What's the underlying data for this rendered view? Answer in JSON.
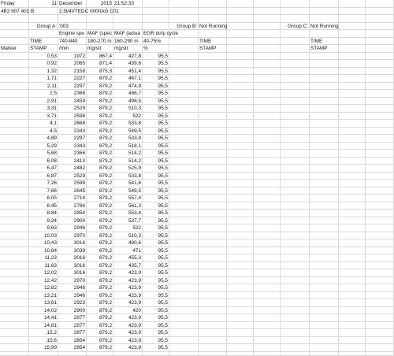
{
  "header_rows": [
    [
      "Friday",
      "11",
      "December",
      "2015",
      "21:52:33",
      "",
      "",
      "",
      "",
      "",
      "",
      "",
      "",
      ""
    ],
    [
      "4B2 907 401 B",
      "",
      "2,5l/4VTEDC 0000AG D01",
      "",
      "",
      "",
      "",
      "",
      "",
      "",
      "",
      "",
      "",
      ""
    ],
    [
      "",
      "",
      "",
      "",
      "",
      "",
      "",
      "",
      "",
      "",
      "",
      "",
      "",
      ""
    ],
    [
      "",
      "Group A:",
      "'003",
      "",
      "",
      "",
      "Group B:",
      "Not Running",
      "",
      "",
      "Group C:",
      "Not Running",
      "",
      ""
    ],
    [
      "",
      "",
      "Engine spe",
      "MAF (spec",
      "MAF (actua",
      "EGR duty cycle",
      "",
      "",
      "",
      "",
      "",
      "",
      "",
      ""
    ],
    [
      "",
      "TIME",
      "740-840",
      "180-270 m",
      "160-290 m",
      "40-75%",
      "",
      "TIME",
      "",
      "",
      "",
      "TIME",
      "",
      ""
    ],
    [
      "Marker",
      "STAMP",
      "/min",
      "mg/str",
      "mg/str",
      "%",
      "",
      "STAMP",
      "",
      "",
      "",
      "STAMP",
      "",
      ""
    ]
  ],
  "rows": [
    [
      "0,53",
      "1972",
      "867,4",
      "427,8",
      "95,5"
    ],
    [
      "0,92",
      "2065",
      "871,4",
      "439,6",
      "95,5"
    ],
    [
      "1,32",
      "2158",
      "875,3",
      "451,4",
      "95,5"
    ],
    [
      "1,71",
      "2227",
      "879,2",
      "467,1",
      "95,5"
    ],
    [
      "2,11",
      "2297",
      "879,2",
      "474,9",
      "95,5"
    ],
    [
      "2,5",
      "2366",
      "879,2",
      "486,7",
      "95,5"
    ],
    [
      "2,91",
      "2459",
      "879,2",
      "498,5",
      "95,5"
    ],
    [
      "3,31",
      "2529",
      "879,2",
      "510,3",
      "95,5"
    ],
    [
      "3,71",
      "2598",
      "879,2",
      "522",
      "95,5"
    ],
    [
      "4,1",
      "2668",
      "879,2",
      "533,8",
      "95,5"
    ],
    [
      "4,5",
      "2343",
      "879,2",
      "549,5",
      "95,5"
    ],
    [
      "4,89",
      "2297",
      "879,2",
      "533,8",
      "95,5"
    ],
    [
      "5,29",
      "2343",
      "879,2",
      "518,1",
      "95,5"
    ],
    [
      "5,68",
      "2366",
      "879,2",
      "514,2",
      "95,5"
    ],
    [
      "6,08",
      "2413",
      "879,2",
      "514,2",
      "95,5"
    ],
    [
      "6,47",
      "2482",
      "879,2",
      "525,9",
      "95,5"
    ],
    [
      "6,87",
      "2529",
      "879,2",
      "533,8",
      "95,5"
    ],
    [
      "7,26",
      "2598",
      "879,2",
      "541,6",
      "95,5"
    ],
    [
      "7,66",
      "2645",
      "879,2",
      "549,5",
      "95,5"
    ],
    [
      "8,05",
      "2714",
      "879,2",
      "557,4",
      "95,5"
    ],
    [
      "8,45",
      "2784",
      "879,2",
      "561,3",
      "95,5"
    ],
    [
      "8,84",
      "2854",
      "879,2",
      "553,4",
      "95,5"
    ],
    [
      "9,24",
      "2900",
      "879,2",
      "537,7",
      "95,5"
    ],
    [
      "9,63",
      "2946",
      "879,2",
      "522",
      "95,5"
    ],
    [
      "10,03",
      "2970",
      "879,2",
      "510,3",
      "95,5"
    ],
    [
      "10,43",
      "3016",
      "879,2",
      "490,6",
      "95,5"
    ],
    [
      "10,84",
      "3039",
      "879,2",
      "471",
      "95,5"
    ],
    [
      "11,23",
      "3016",
      "879,2",
      "455,3",
      "95,5"
    ],
    [
      "11,63",
      "3016",
      "879,2",
      "435,7",
      "95,5"
    ],
    [
      "12,02",
      "3016",
      "879,2",
      "423,9",
      "95,5"
    ],
    [
      "12,42",
      "2970",
      "879,2",
      "423,9",
      "95,5"
    ],
    [
      "12,82",
      "2946",
      "879,2",
      "423,9",
      "95,5"
    ],
    [
      "13,21",
      "2946",
      "879,2",
      "423,9",
      "95,5"
    ],
    [
      "13,61",
      "2923",
      "879,2",
      "423,9",
      "95,5"
    ],
    [
      "14,02",
      "2900",
      "879,2",
      "420",
      "95,5"
    ],
    [
      "14,41",
      "2877",
      "879,2",
      "423,9",
      "95,5"
    ],
    [
      "14,81",
      "2877",
      "879,2",
      "423,9",
      "95,5"
    ],
    [
      "15,2",
      "2877",
      "879,2",
      "423,9",
      "95,5"
    ],
    [
      "15,6",
      "2854",
      "879,2",
      "423,9",
      "95,5"
    ],
    [
      "15,99",
      "2854",
      "879,2",
      "423,9",
      "95,5"
    ]
  ]
}
